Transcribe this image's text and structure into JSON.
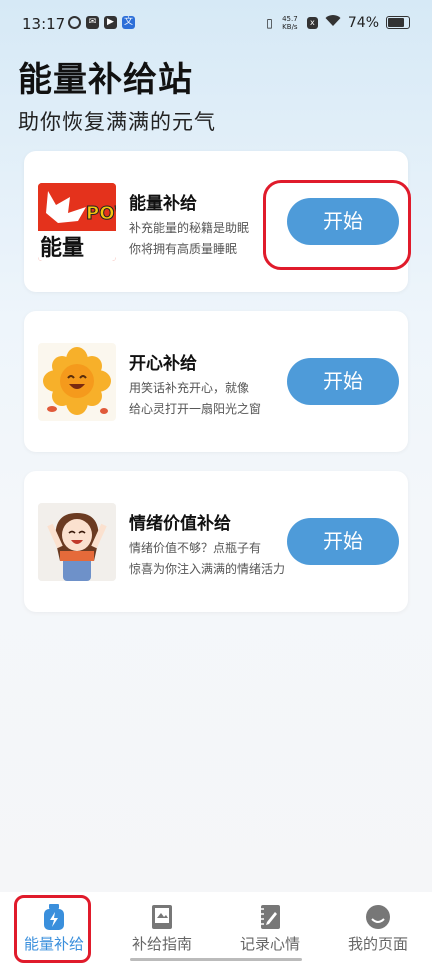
{
  "status_bar": {
    "time": "13:17",
    "network_speed_value": "45.7",
    "network_speed_unit": "KB/s",
    "battery": "74%"
  },
  "header": {
    "title": "能量补给站",
    "subtitle": "助你恢复满满的元气"
  },
  "cards": [
    {
      "title": "能量补给",
      "desc_line1": "补充能量的秘籍是助眠",
      "desc_line2": "你将拥有高质量睡眠",
      "button": "开始",
      "thumb_text_1": "POW",
      "thumb_text_2": "能量"
    },
    {
      "title": "开心补给",
      "desc_line1": "用笑话补充开心，就像",
      "desc_line2": "给心灵打开一扇阳光之窗",
      "button": "开始"
    },
    {
      "title": "情绪价值补给",
      "desc_line1": "情绪价值不够？点瓶子有",
      "desc_line2": "惊喜为你注入满满的情绪活力",
      "button": "开始"
    }
  ],
  "tabs": [
    {
      "label": "能量补给",
      "active": true
    },
    {
      "label": "补给指南",
      "active": false
    },
    {
      "label": "记录心情",
      "active": false
    },
    {
      "label": "我的页面",
      "active": false
    }
  ],
  "colors": {
    "accent": "#4e9bd9",
    "active_tab": "#3a8fdc",
    "highlight": "#e01b2b"
  }
}
